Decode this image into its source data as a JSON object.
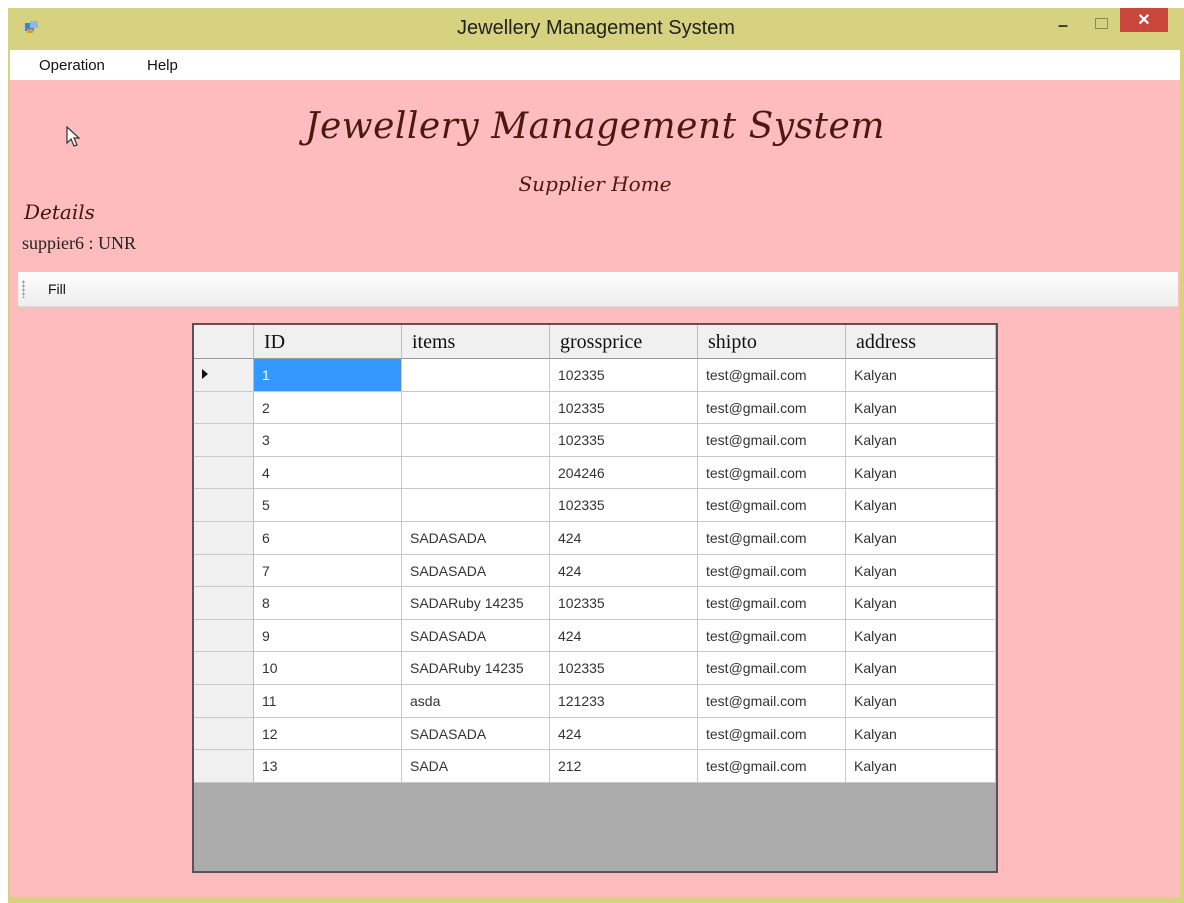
{
  "window": {
    "title": "Jewellery Management System",
    "minimize_label": "–",
    "close_label": "✕"
  },
  "menu": {
    "items": [
      "Operation",
      "Help"
    ]
  },
  "form": {
    "heading": "Jewellery Management System",
    "subheading": "Supplier Home",
    "details_label": "Details",
    "supplier_info": "suppier6 : UNR"
  },
  "toolbar": {
    "fill_label": "Fill"
  },
  "table": {
    "columns": [
      "ID",
      "items",
      "grossprice",
      "shipto",
      "address"
    ],
    "selected_row": 0,
    "rows": [
      [
        "1",
        "",
        "102335",
        "test@gmail.com",
        "Kalyan"
      ],
      [
        "2",
        "",
        "102335",
        "test@gmail.com",
        "Kalyan"
      ],
      [
        "3",
        "",
        "102335",
        "test@gmail.com",
        "Kalyan"
      ],
      [
        "4",
        "",
        "204246",
        "test@gmail.com",
        "Kalyan"
      ],
      [
        "5",
        "",
        "102335",
        "test@gmail.com",
        "Kalyan"
      ],
      [
        "6",
        "SADASADA",
        "424",
        "test@gmail.com",
        "Kalyan"
      ],
      [
        "7",
        "SADASADA",
        "424",
        "test@gmail.com",
        "Kalyan"
      ],
      [
        "8",
        "SADARuby 14235",
        "102335",
        "test@gmail.com",
        "Kalyan"
      ],
      [
        "9",
        "SADASADA",
        "424",
        "test@gmail.com",
        "Kalyan"
      ],
      [
        "10",
        "SADARuby 14235",
        "102335",
        "test@gmail.com",
        "Kalyan"
      ],
      [
        "11",
        "asda",
        "121233",
        "test@gmail.com",
        "Kalyan"
      ],
      [
        "12",
        "SADASADA",
        "424",
        "test@gmail.com",
        "Kalyan"
      ],
      [
        "13",
        "SADA",
        "212",
        "test@gmail.com",
        "Kalyan"
      ]
    ]
  },
  "colors": {
    "title_bar": "#d6d27f",
    "form_background": "#ffbcbe",
    "selection": "#3399ff",
    "close_button": "#c8463c",
    "grid_empty": "#ababab"
  },
  "icons": [
    "app-icon",
    "mouse-pointer-icon",
    "row-indicator-icon",
    "minimize-icon",
    "maximize-icon",
    "close-icon"
  ]
}
